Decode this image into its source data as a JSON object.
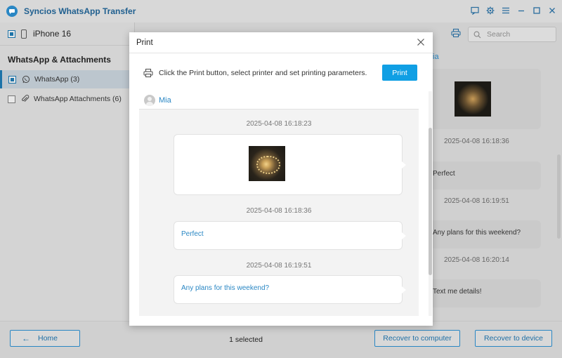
{
  "app": {
    "title": "Syncios WhatsApp Transfer",
    "accent_color": "#2a87c4",
    "window_icons": [
      "feedback-icon",
      "settings-icon",
      "menu-icon",
      "minimize-icon",
      "maximize-icon",
      "close-icon"
    ]
  },
  "device": {
    "name": "iPhone 16"
  },
  "sidebar": {
    "section_title": "WhatsApp & Attachments",
    "items": [
      {
        "label": "WhatsApp (3)",
        "icon": "whatsapp-icon",
        "checked": "partial",
        "selected": true
      },
      {
        "label": "WhatsApp Attachments (6)",
        "icon": "paperclip-icon",
        "checked": "none",
        "selected": false
      }
    ]
  },
  "search": {
    "placeholder": "Search"
  },
  "background_chat": {
    "contact_partial": "ia",
    "messages": [
      {
        "type": "image",
        "timestamp": "2025-04-08 16:18:36"
      },
      {
        "type": "text",
        "text": "Perfect",
        "timestamp": "2025-04-08 16:19:51"
      },
      {
        "type": "text",
        "text": "Any plans for this weekend?",
        "timestamp": "2025-04-08 16:20:14"
      },
      {
        "type": "text",
        "text": "Text me details!"
      }
    ]
  },
  "bottom": {
    "home_label": "Home",
    "selected_text": "1 selected",
    "recover_computer_label": "Recover to computer",
    "recover_device_label": "Recover to device"
  },
  "print_dialog": {
    "title": "Print",
    "instruction": "Click the Print button, select printer and set printing parameters.",
    "print_label": "Print",
    "print_color": "#109fe4",
    "preview": {
      "contact_name": "Mia",
      "messages": [
        {
          "timestamp": "2025-04-08 16:18:23",
          "type": "image"
        },
        {
          "timestamp": "2025-04-08 16:18:36",
          "type": "text",
          "text": "Perfect"
        },
        {
          "timestamp": "2025-04-08 16:19:51",
          "type": "text",
          "text": "Any plans for this weekend?"
        }
      ]
    }
  }
}
